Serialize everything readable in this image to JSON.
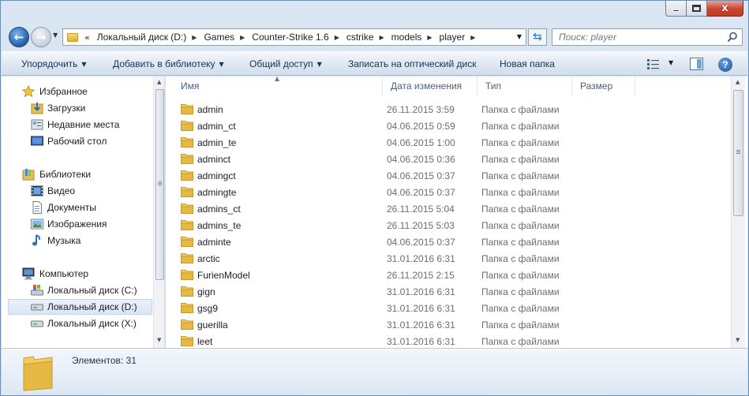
{
  "window": {
    "caption_close": "x"
  },
  "nav": {
    "back_arrow": "←",
    "forward_arrow": "→",
    "address_overflow": "«",
    "breadcrumbs": [
      {
        "label": "Локальный диск (D:)"
      },
      {
        "label": "Games"
      },
      {
        "label": "Counter-Strike 1.6"
      },
      {
        "label": "cstrike"
      },
      {
        "label": "models"
      },
      {
        "label": "player"
      }
    ],
    "search_placeholder": "Поиск: player"
  },
  "toolbar": {
    "organize": "Упорядочить",
    "add_to_library": "Добавить в библиотеку",
    "share": "Общий доступ",
    "burn": "Записать на оптический диск",
    "new_folder": "Новая папка",
    "help": "?"
  },
  "sidebar": {
    "items": [
      {
        "label": "Избранное",
        "icon": "star-icon"
      },
      {
        "label": "Загрузки",
        "icon": "downloads-icon"
      },
      {
        "label": "Недавние места",
        "icon": "recent-places-icon"
      },
      {
        "label": "Рабочий стол",
        "icon": "desktop-icon"
      },
      {
        "label": "Библиотеки",
        "icon": "libraries-icon"
      },
      {
        "label": "Видео",
        "icon": "video-icon"
      },
      {
        "label": "Документы",
        "icon": "documents-icon"
      },
      {
        "label": "Изображения",
        "icon": "pictures-icon"
      },
      {
        "label": "Музыка",
        "icon": "music-icon"
      },
      {
        "label": "Компьютер",
        "icon": "computer-icon"
      },
      {
        "label": "Локальный диск (C:)",
        "icon": "system-drive-icon"
      },
      {
        "label": "Локальный диск (D:)",
        "icon": "drive-icon",
        "selected": true
      },
      {
        "label": "Локальный диск (X:)",
        "icon": "drive-icon"
      }
    ]
  },
  "columns": {
    "name": "Имя",
    "date": "Дата изменения",
    "type": "Тип",
    "size": "Размер"
  },
  "files": [
    {
      "name": "admin",
      "date": "26.11.2015 3:59",
      "type": "Папка с файлами"
    },
    {
      "name": "admin_ct",
      "date": "04.06.2015 0:59",
      "type": "Папка с файлами"
    },
    {
      "name": "admin_te",
      "date": "04.06.2015 1:00",
      "type": "Папка с файлами"
    },
    {
      "name": "adminct",
      "date": "04.06.2015 0:36",
      "type": "Папка с файлами"
    },
    {
      "name": "admingct",
      "date": "04.06.2015 0:37",
      "type": "Папка с файлами"
    },
    {
      "name": "admingte",
      "date": "04.06.2015 0:37",
      "type": "Папка с файлами"
    },
    {
      "name": "admins_ct",
      "date": "26.11.2015 5:04",
      "type": "Папка с файлами"
    },
    {
      "name": "admins_te",
      "date": "26.11.2015 5:03",
      "type": "Папка с файлами"
    },
    {
      "name": "adminte",
      "date": "04.06.2015 0:37",
      "type": "Папка с файлами"
    },
    {
      "name": "arctic",
      "date": "31.01.2016 6:31",
      "type": "Папка с файлами"
    },
    {
      "name": "FurienModel",
      "date": "26.11.2015 2:15",
      "type": "Папка с файлами"
    },
    {
      "name": "gign",
      "date": "31.01.2016 6:31",
      "type": "Папка с файлами"
    },
    {
      "name": "gsg9",
      "date": "31.01.2016 6:31",
      "type": "Папка с файлами"
    },
    {
      "name": "guerilla",
      "date": "31.01.2016 6:31",
      "type": "Папка с файлами"
    },
    {
      "name": "leet",
      "date": "31.01.2016 6:31",
      "type": "Папка с файлами"
    }
  ],
  "status": {
    "items_count": "Элементов: 31"
  },
  "colors": {
    "window_frame": "#cfdcec",
    "close_button": "#c9442f",
    "folder_yellow": "#e8c04f",
    "selection": "#dbe6f5"
  }
}
